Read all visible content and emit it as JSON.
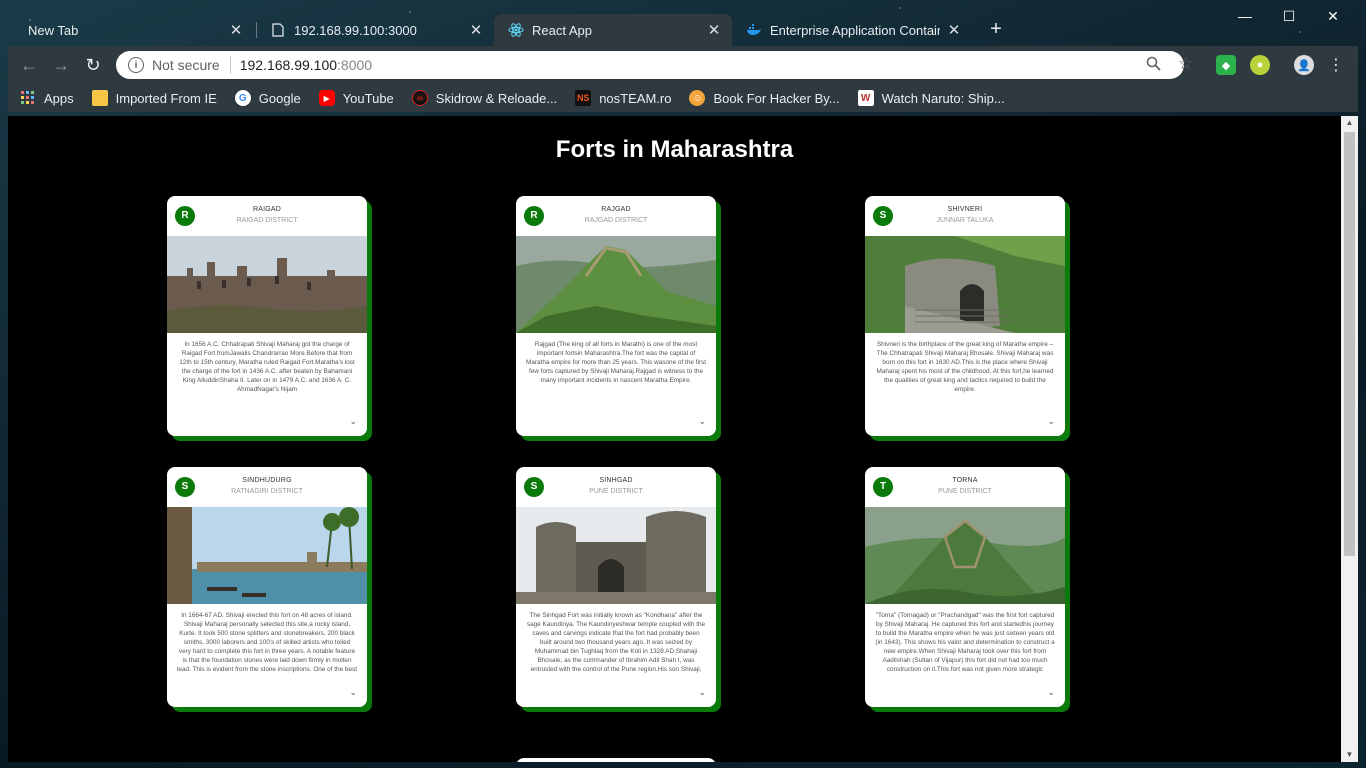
{
  "browser": {
    "tabs": [
      {
        "title": "New Tab",
        "icon": "none"
      },
      {
        "title": "192.168.99.100:3000",
        "icon": "page-icon"
      },
      {
        "title": "React App",
        "icon": "react-icon"
      },
      {
        "title": "Enterprise Application Container",
        "icon": "docker-icon"
      }
    ],
    "url": {
      "security": "Not secure",
      "host": "192.168.99.100",
      "port": ":8000"
    },
    "bookmarks": [
      {
        "label": "Apps",
        "icon": "apps-grid-icon"
      },
      {
        "label": "Imported From IE",
        "icon": "folder-icon"
      },
      {
        "label": "Google",
        "icon": "google-icon"
      },
      {
        "label": "YouTube",
        "icon": "youtube-icon"
      },
      {
        "label": "Skidrow & Reloade...",
        "icon": "skidrow-icon"
      },
      {
        "label": "nosTEAM.ro",
        "icon": "nosteam-icon"
      },
      {
        "label": "Book For Hacker By...",
        "icon": "book-icon"
      },
      {
        "label": "Watch Naruto: Ship...",
        "icon": "w-icon"
      }
    ]
  },
  "page": {
    "title": "Forts in Maharashtra",
    "cards": [
      {
        "initial": "R",
        "name": "RAIGAD",
        "district": "RAIGAD DISTRICT",
        "image": "fort-ruins-photo",
        "description": "In 1656 A.C. Chhatrapati Shivaji Maharaj got the charge of Raigad Fort fromJawalis Chandrarrao More.Before that from 12th to 15th century, Maratha ruled Raigad Fort.Maratha's lost the charge of the fort in 1436 A.C. after beaten by Bahamani King AlluddinShaha II. Later on in 1479 A.C. and 1636 A. C. AhmadNagar's Nijam"
      },
      {
        "initial": "R",
        "name": "RAJGAD",
        "district": "RAJGAD DISTRICT",
        "image": "green-hill-fort-photo",
        "description": "Rajgad (The king of all forts in Marathi) is one of the most important fortsin Maharashtra.The fort was the capital of Maratha empire for more than 25 years. This wasone of the first few forts captured by Shivaji Maharaj.Rajgad is witness to the many important incidents in nascent Maratha Empire."
      },
      {
        "initial": "S",
        "name": "SHIVNERI",
        "district": "JUNNAR TALUKA",
        "image": "stone-gateway-photo",
        "description": "Shivneri is the birthplace of the great king of Maratha empire – The Chhatrapati Shivaji Maharaj Bhosale. Shivaji Maharaj was born on this fort in 1630 AD.This is the place where Shivaji Maharaj spent his most of the childhood. At this fort,he learned the qualities of great king and tactics required to build the empire."
      },
      {
        "initial": "S",
        "name": "SINDHUDURG",
        "district": "RATNAGIRI DISTRICT",
        "image": "sea-fort-photo",
        "description": "In 1664-67 AD, Shivaji erected this fort on 48 acres of island. Shivaji Maharaj personally selected this site,a rocky island, Kurte. It took 500 stone splitters and stonebreakers, 200 black smiths, 3000 laborers and 100's of skilled artists who toiled very hard to complete this fort in three years. A notable feature is that the foundation stones were laid down firmly in molten lead. This is evident from the stone inscriptions. One of the best preserved"
      },
      {
        "initial": "S",
        "name": "SINHGAD",
        "district": "PUNE DISTRICT",
        "image": "bastion-gate-photo",
        "description": "The Sinhgad Fort was initially known as \"Kondhana\" after the sage Kaundinya. The Kaundinyeshwar temple coupled with the caves and carvings indicate that the fort had probably been built around two thousand years ago. It was seized by Muhammad bin Tughlaq from the Koli in 1328 AD.Shahaji Bhosale, as the commander of Ibrahim Adil Shah I, was entrusted with the control of the Pune region.His son Shivaji, refused to accept the Adilshahi"
      },
      {
        "initial": "T",
        "name": "TORNA",
        "district": "PUNE DISTRICT",
        "image": "hilltop-fort-photo",
        "description": "\"Torna\" (Tornagad) or \"Prachandgad\" was the first fort captured by Shivaji Maharaj. He captured this fort and startedhis journey to build the Maratha empire when he was just sixteen years old (in 1643). This shows his valor and determination to construct a new empire.When Shivaji Maharaj took over this fort from Aadilshah (Sultan of Vijapur) this fort did not had too much construction on it.This fort was not given more strategic importance"
      }
    ]
  },
  "colors": {
    "accent_green": "#0a7a0a",
    "page_bg": "#000000",
    "chrome_bg": "#2f3a40"
  }
}
